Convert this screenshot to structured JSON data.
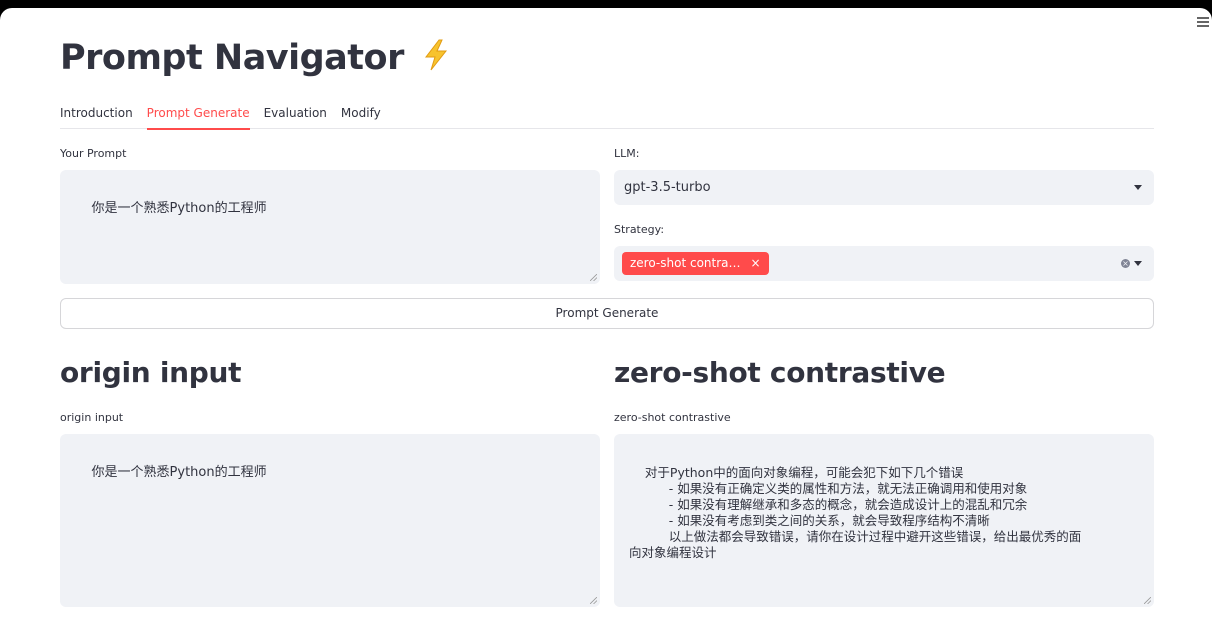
{
  "app": {
    "title": "Prompt Navigator",
    "title_icon": "lightning-bolt-icon"
  },
  "tabs": [
    {
      "label": "Introduction",
      "active": false
    },
    {
      "label": "Prompt Generate",
      "active": true
    },
    {
      "label": "Evaluation",
      "active": false
    },
    {
      "label": "Modify",
      "active": false
    }
  ],
  "form": {
    "prompt_label": "Your Prompt",
    "prompt_value": "你是一个熟悉Python的工程师",
    "llm_label": "LLM:",
    "llm_value": "gpt-3.5-turbo",
    "strategy_label": "Strategy:",
    "strategy_tag": "zero-shot contra…",
    "strategy_tag_remove": "×",
    "generate_button": "Prompt Generate"
  },
  "results": {
    "left_heading": "origin input",
    "left_label": "origin input",
    "left_value": "你是一个熟悉Python的工程师",
    "right_heading": "zero-shot contrastive",
    "right_label": "zero-shot contrastive",
    "right_value": "对于Python中的面向对象编程，可能会犯下如下几个错误\n          - 如果没有正确定义类的属性和方法，就无法正确调用和使用对象\n          - 如果没有理解继承和多态的概念，就会造成设计上的混乱和冗余\n          - 如果没有考虑到类之间的关系，就会导致程序结构不清晰\n          以上做法都会导致错误，请你在设计过程中避开这些错误，给出最优秀的面\n向对象编程设计"
  },
  "colors": {
    "accent": "#ff4b4b",
    "input_bg": "#f0f2f6",
    "text": "#31333f"
  }
}
